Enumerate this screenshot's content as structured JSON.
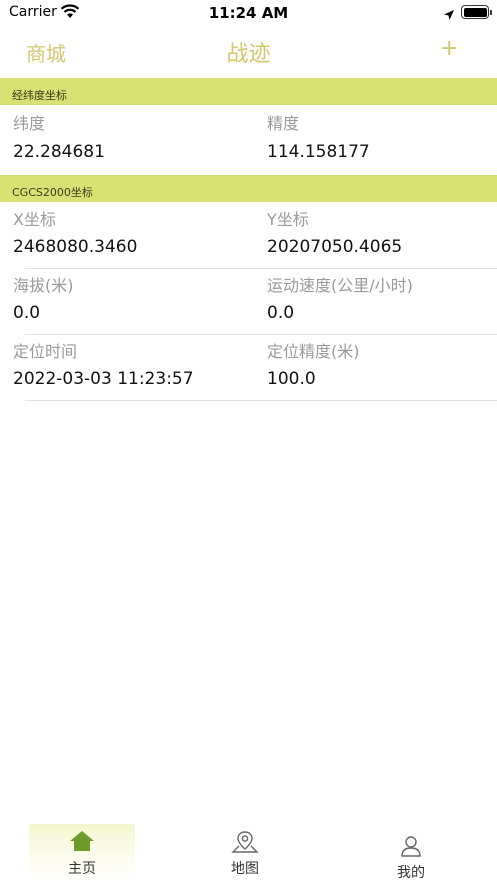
{
  "status_bar": {
    "carrier": "Carrier",
    "time": "11:24 AM"
  },
  "nav": {
    "left": "商城",
    "title": "战迹",
    "right": "+"
  },
  "sections": [
    {
      "title": "经纬度坐标"
    },
    {
      "title": "CGCS2000坐标"
    }
  ],
  "latlng": {
    "lat_label": "纬度",
    "lat_value": "22.284681",
    "lng_label": "精度",
    "lng_value": "114.158177"
  },
  "cgcs": {
    "x_label": "X坐标",
    "x_value": "2468080.3460",
    "y_label": "Y坐标",
    "y_value": "20207050.4065",
    "alt_label": "海拔(米)",
    "alt_value": "0.0",
    "speed_label": "运动速度(公里/小时)",
    "speed_value": "0.0",
    "time_label": "定位时间",
    "time_value": "2022-03-03 11:23:57",
    "acc_label": "定位精度(米)",
    "acc_value": "100.0"
  },
  "tabs": [
    {
      "label": "主页",
      "icon": "home-icon",
      "active": true
    },
    {
      "label": "地图",
      "icon": "map-pin-icon",
      "active": false
    },
    {
      "label": "我的",
      "icon": "user-icon",
      "active": false
    }
  ],
  "colors": {
    "accent": "#d4c76a",
    "section_bg": "#d8e173",
    "tab_active": "#6e9a2c"
  }
}
